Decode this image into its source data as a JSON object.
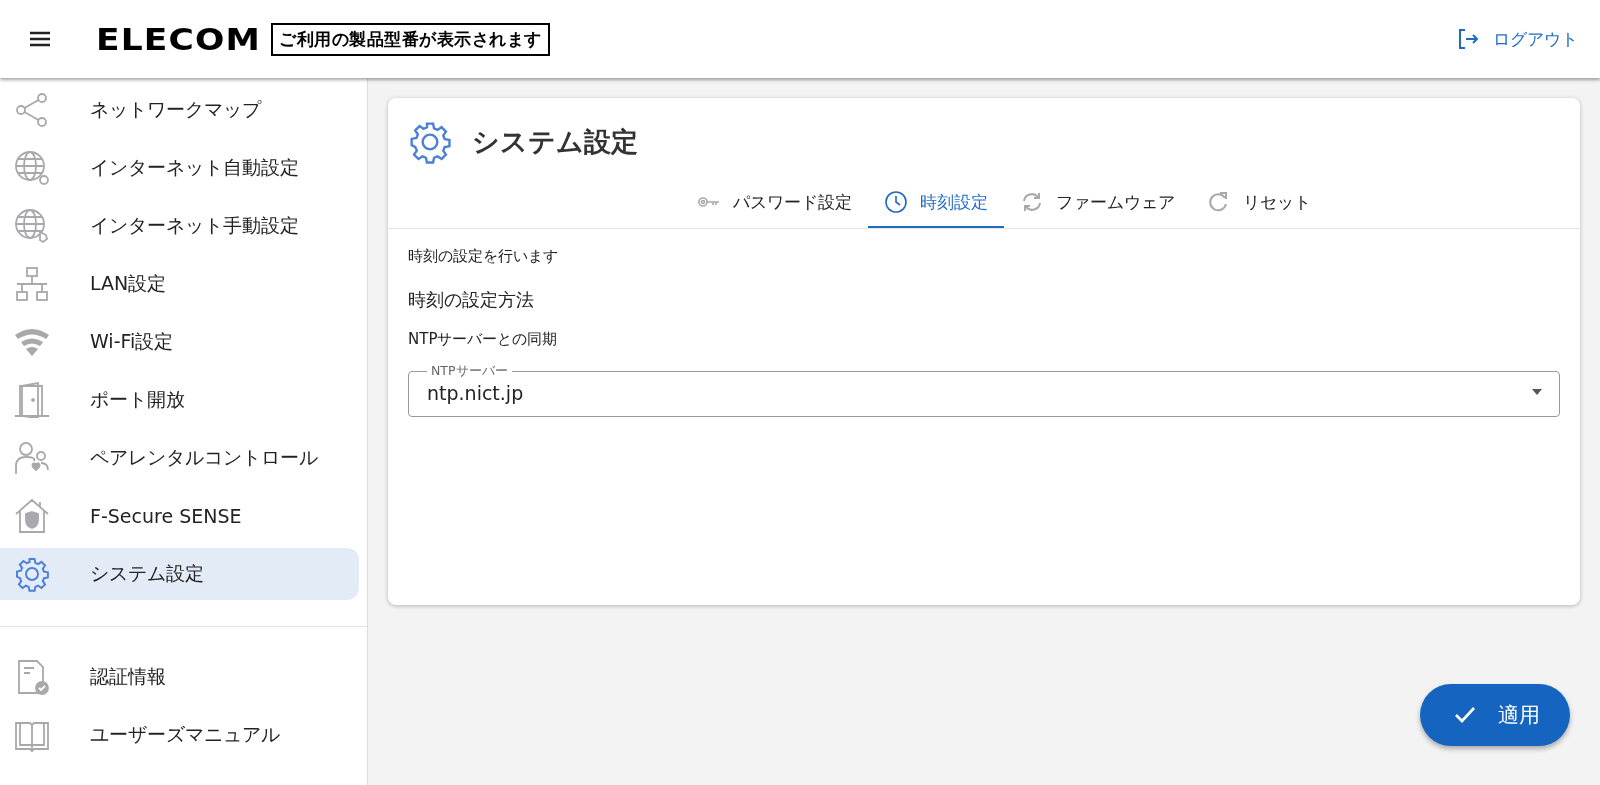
{
  "header": {
    "logo": "ELECOM",
    "model_label": "ご利用の製品型番が表示されます",
    "logout": "ログアウト"
  },
  "sidebar": {
    "items": [
      {
        "label": "ネットワークマップ",
        "selected": false
      },
      {
        "label": "インターネット自動設定",
        "selected": false
      },
      {
        "label": "インターネット手動設定",
        "selected": false
      },
      {
        "label": "LAN設定",
        "selected": false
      },
      {
        "label": "Wi-Fi設定",
        "selected": false
      },
      {
        "label": "ポート開放",
        "selected": false
      },
      {
        "label": "ペアレンタルコントロール",
        "selected": false
      },
      {
        "label": "F-Secure SENSE",
        "selected": false
      },
      {
        "label": "システム設定",
        "selected": true
      }
    ],
    "footer_items": [
      {
        "label": "認証情報",
        "selected": false
      },
      {
        "label": "ユーザーズマニュアル",
        "selected": false
      }
    ]
  },
  "page": {
    "title": "システム設定",
    "tabs": [
      {
        "label": "パスワード設定",
        "selected": false
      },
      {
        "label": "時刻設定",
        "selected": true
      },
      {
        "label": "ファームウェア",
        "selected": false
      },
      {
        "label": "リセット",
        "selected": false
      }
    ],
    "description": "時刻の設定を行います",
    "section_title": "時刻の設定方法",
    "subsection": "NTPサーバーとの同期",
    "ntp_field": {
      "label": "NTPサーバー",
      "value": "ntp.nict.jp"
    }
  },
  "apply_button": "適用"
}
